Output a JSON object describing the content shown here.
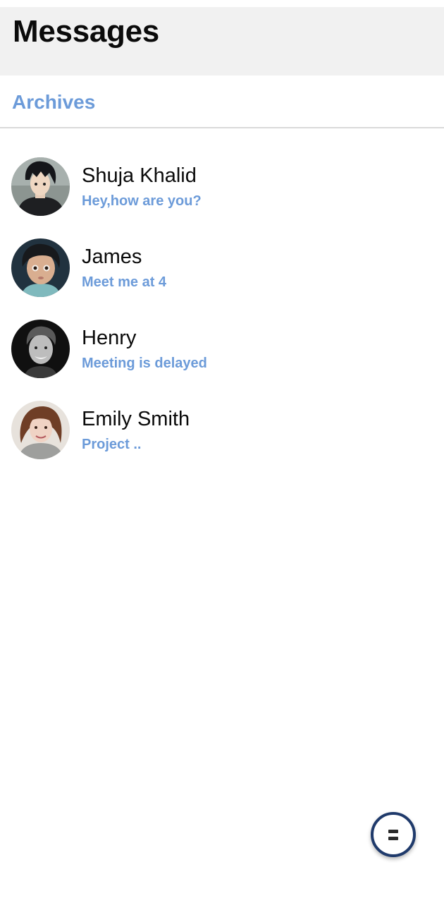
{
  "header": {
    "title": "Messages"
  },
  "archives": {
    "label": "Archives"
  },
  "conversations": [
    {
      "name": "Shuja Khalid",
      "preview": "Hey,how are you?",
      "avatar": "anime-character-avatar"
    },
    {
      "name": "James",
      "preview": "Meet me at 4",
      "avatar": "child-photo-avatar"
    },
    {
      "name": "Henry",
      "preview": "Meeting is delayed",
      "avatar": "man-bw-photo-avatar"
    },
    {
      "name": "Emily Smith",
      "preview": "Project ..",
      "avatar": "woman-photo-avatar"
    }
  ],
  "fab": {
    "icon": "menu-icon"
  },
  "colors": {
    "accent": "#6c9bd9",
    "header_bg": "#f1f1f1",
    "fab_border": "#1f3a6b",
    "text": "#0a0a0a"
  }
}
